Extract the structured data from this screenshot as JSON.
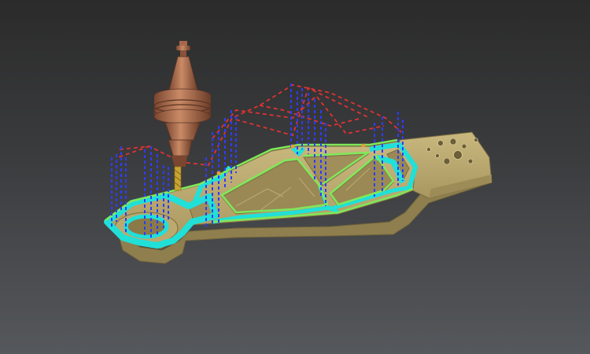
{
  "scene": {
    "background_top": "#2b2b2b",
    "background_bottom": "#55585c",
    "part_color": "#bba96e",
    "part_shadow": "#8f7f4f",
    "toolpath_cut_color": "#20e0d8",
    "contour_color": "#7fe85a",
    "rapid_move_color": "#e03232",
    "plunge_color": "#2e3cff",
    "tool_holder_color": "#b87352",
    "tool_bit_color": "#c9a431"
  },
  "icons": {
    "tool": "cutter-tool-icon"
  }
}
